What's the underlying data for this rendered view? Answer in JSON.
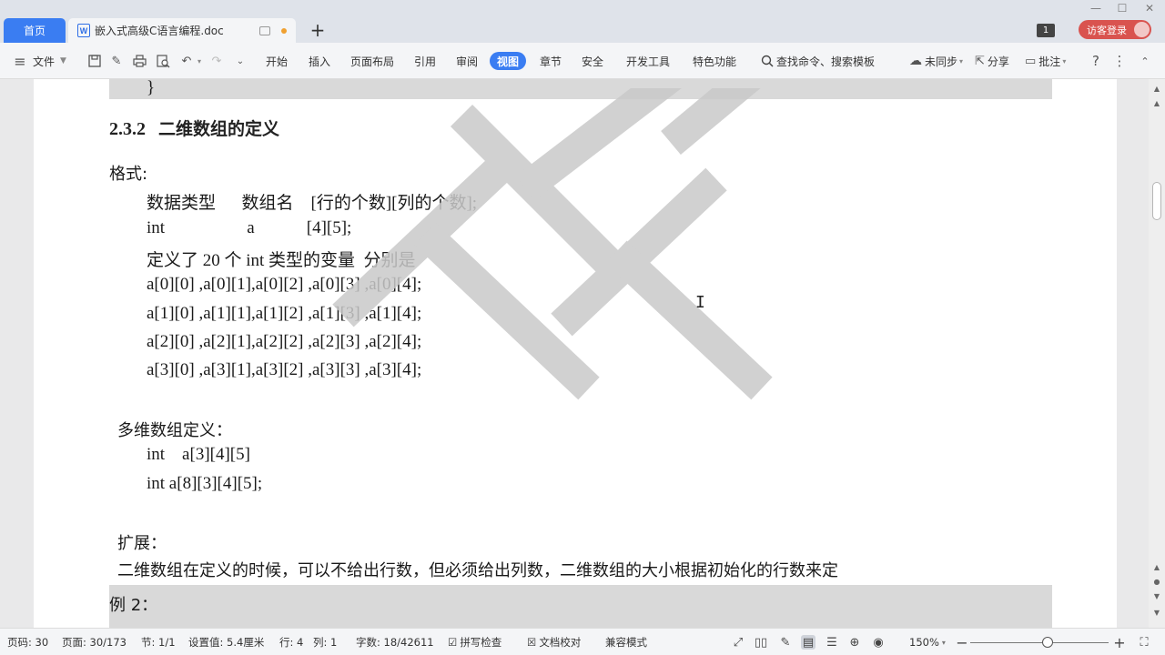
{
  "tabs": {
    "home": "首页",
    "doc_title": "嵌入式高级C语言编程.doc",
    "doc_badge": "W",
    "add": "+",
    "window_badge": "1",
    "login": "访客登录"
  },
  "window_controls": {
    "minimize": "—",
    "maximize": "☐",
    "close": "✕"
  },
  "menu": {
    "file": "文件",
    "items": [
      "开始",
      "插入",
      "页面布局",
      "引用",
      "审阅",
      "视图",
      "章节",
      "安全",
      "开发工具",
      "特色功能"
    ],
    "active": "视图",
    "search": "查找命令、搜索模板",
    "sync": "未同步",
    "share": "分享",
    "comment": "批注"
  },
  "document": {
    "closing_brace": "}",
    "heading_num": "2.3.2",
    "heading_title": "二维数组的定义",
    "lines": [
      "格式:",
      "数据类型      数组名    [行的个数][列的个数];",
      "int                   a            [4][5];",
      "定义了 20 个 int 类型的变量  分别是",
      "a[0][0] ,a[0][1],a[0][2] ,a[0][3] ,a[0][4];",
      "a[1][0] ,a[1][1],a[1][2] ,a[1][3] ,a[1][4];",
      "a[2][0] ,a[2][1],a[2][2] ,a[2][3] ,a[2][4];",
      "a[3][0] ,a[3][1],a[3][2] ,a[3][3] ,a[3][4];",
      "多维数组定义：",
      "int    a[3][4][5]",
      "int a[8][3][4][5];",
      "扩展：",
      "二维数组在定义的时候，可以不给出行数，但必须给出列数，二维数组的大小根据初始化的行数来定",
      "例 2："
    ]
  },
  "status": {
    "page_code": "页码: 30",
    "pages": "页面: 30/173",
    "section": "节: 1/1",
    "setting": "设置值: 5.4厘米",
    "row": "行: 4",
    "col": "列: 1",
    "words": "字数: 18/42611",
    "spell": "拼写检查",
    "proof": "文档校对",
    "compat": "兼容模式",
    "zoom": "150%"
  },
  "colors": {
    "accent": "#3a7df2",
    "login": "#d9534f",
    "shade": "#d9d9d9"
  }
}
